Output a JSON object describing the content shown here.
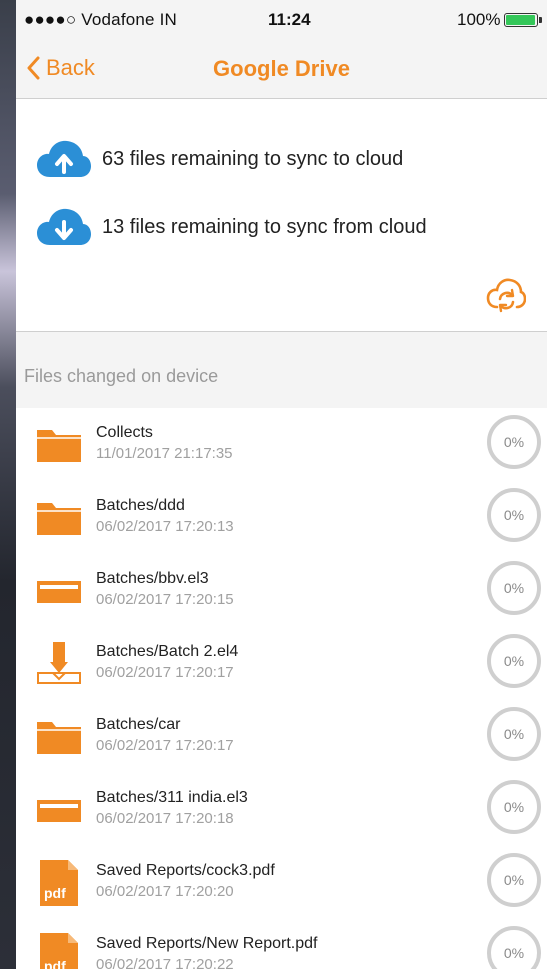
{
  "status_bar": {
    "carrier": "●●●●○ Vodafone IN",
    "time": "11:24",
    "battery": "100%"
  },
  "nav": {
    "back_label": "Back",
    "title": "Google Drive"
  },
  "sync": {
    "upload_text": "63 files remaining to sync to cloud",
    "download_text": "13 files remaining to sync from cloud"
  },
  "section": {
    "title": "Files changed on device"
  },
  "files": [
    {
      "name": "Collects",
      "date": "11/01/2017 21:17:35",
      "icon": "folder-icon",
      "progress": "0%"
    },
    {
      "name": "Batches/ddd",
      "date": "06/02/2017 17:20:13",
      "icon": "folder-icon",
      "progress": "0%"
    },
    {
      "name": "Batches/bbv.el3",
      "date": "06/02/2017 17:20:15",
      "icon": "el3-file-icon",
      "progress": "0%"
    },
    {
      "name": "Batches/Batch 2.el4",
      "date": "06/02/2017 17:20:17",
      "icon": "el4-file-icon",
      "progress": "0%"
    },
    {
      "name": "Batches/car",
      "date": "06/02/2017 17:20:17",
      "icon": "folder-icon",
      "progress": "0%"
    },
    {
      "name": "Batches/311 india.el3",
      "date": "06/02/2017 17:20:18",
      "icon": "el3-file-icon",
      "progress": "0%"
    },
    {
      "name": "Saved Reports/cock3.pdf",
      "date": "06/02/2017 17:20:20",
      "icon": "pdf-file-icon",
      "progress": "0%"
    },
    {
      "name": "Saved Reports/New Report.pdf",
      "date": "06/02/2017 17:20:22",
      "icon": "pdf-file-icon",
      "progress": "0%"
    }
  ],
  "colors": {
    "accent": "#f08a24",
    "cloud_blue": "#2b8fd6",
    "progress_ring": "#cfcfcf"
  }
}
